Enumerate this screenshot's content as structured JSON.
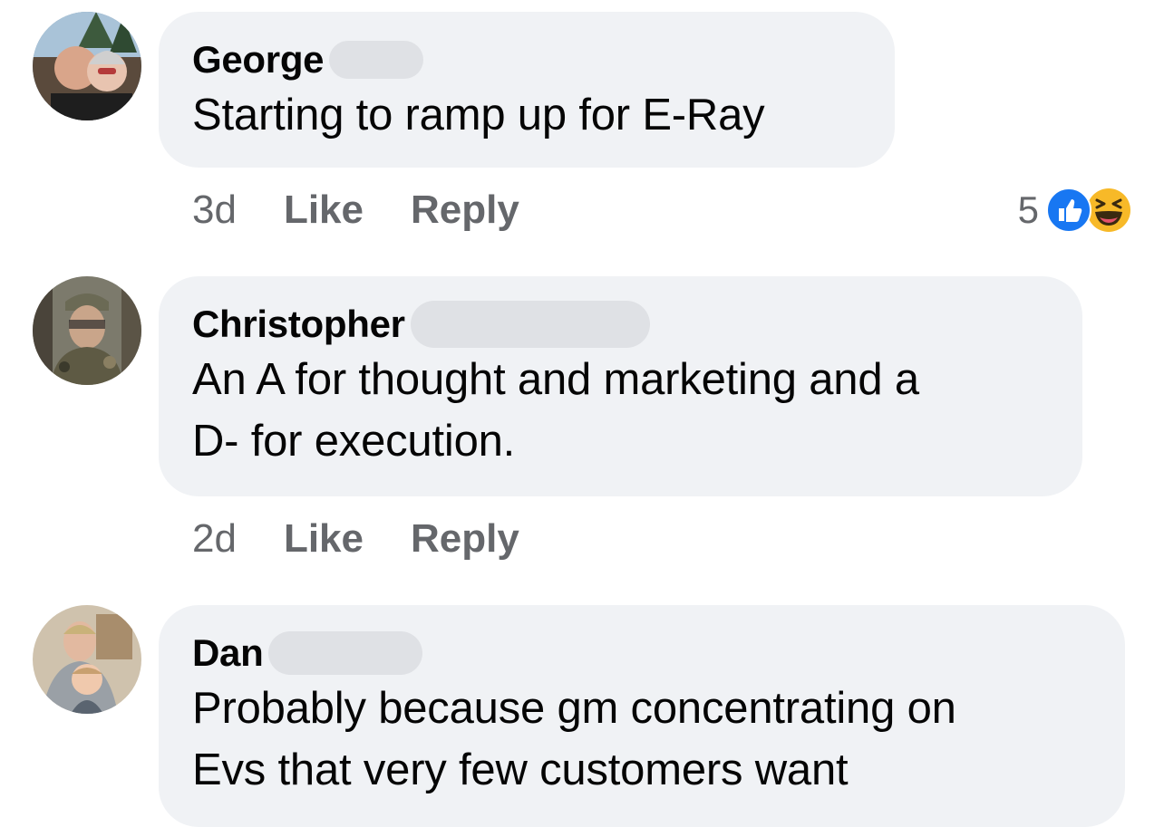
{
  "comments": [
    {
      "author": "George",
      "text": "Starting to ramp up for E-Ray",
      "time": "3d",
      "like_label": "Like",
      "reply_label": "Reply",
      "reaction_count": "5",
      "reaction_icons": [
        "like-icon",
        "haha-icon"
      ]
    },
    {
      "author": "Christopher",
      "text_line1": "An A for thought and marketing and a",
      "text_line2": "D- for execution.",
      "time": "2d",
      "like_label": "Like",
      "reply_label": "Reply"
    },
    {
      "author": "Dan",
      "text_line1": "Probably because gm concentrating on",
      "text_line2": "Evs that very few customers want"
    }
  ],
  "colors": {
    "bubble": "#f0f2f5",
    "meta_text": "#65676b",
    "like_blue": "#1877f2",
    "haha_yellow": "#f7b928"
  }
}
